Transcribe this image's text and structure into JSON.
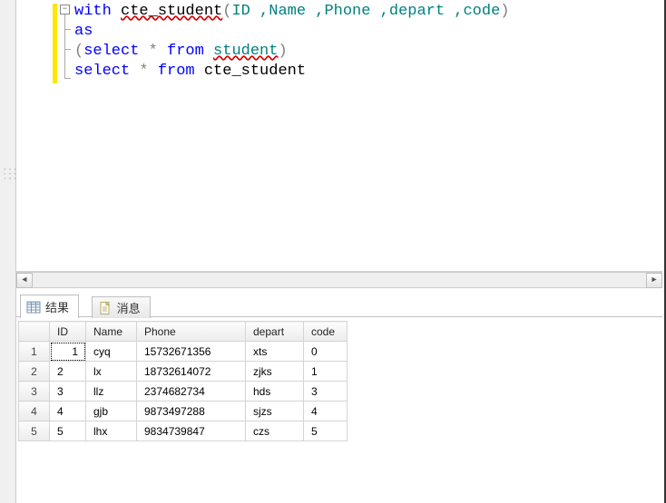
{
  "code": {
    "line1_with": "with",
    "line1_cte": "cte_student",
    "line1_open": "(",
    "line1_cols": "ID ,Name ,Phone ,depart ,code",
    "line1_close": ")",
    "line2_as": "as",
    "line3_open": "(",
    "line3_select": "select",
    "line3_star": " * ",
    "line3_from": "from",
    "line3_space": " ",
    "line3_table": "student",
    "line3_close": ")",
    "line4_select": "select",
    "line4_star": " * ",
    "line4_from": "from",
    "line4_space": " ",
    "line4_target": "cte_student"
  },
  "tabs": {
    "results_label": "结果",
    "messages_label": "消息"
  },
  "grid": {
    "headers": {
      "id": "ID",
      "name": "Name",
      "phone": "Phone",
      "depart": "depart",
      "code": "code"
    },
    "rows": [
      {
        "n": "1",
        "id": "1",
        "name": "cyq",
        "phone": "15732671356",
        "depart": "xts",
        "code": "0"
      },
      {
        "n": "2",
        "id": "2",
        "name": "lx",
        "phone": "18732614072",
        "depart": "zjks",
        "code": "1"
      },
      {
        "n": "3",
        "id": "3",
        "name": "llz",
        "phone": "2374682734",
        "depart": "hds",
        "code": "3"
      },
      {
        "n": "4",
        "id": "4",
        "name": "gjb",
        "phone": "9873497288",
        "depart": "sjzs",
        "code": "4"
      },
      {
        "n": "5",
        "id": "5",
        "name": "lhx",
        "phone": "9834739847",
        "depart": "czs",
        "code": "5"
      }
    ]
  },
  "chart_data": {
    "type": "table",
    "title": "cte_student results",
    "columns": [
      "ID",
      "Name",
      "Phone",
      "depart",
      "code"
    ],
    "rows": [
      [
        1,
        "cyq",
        "15732671356",
        "xts",
        0
      ],
      [
        2,
        "lx",
        "18732614072",
        "zjks",
        1
      ],
      [
        3,
        "llz",
        "2374682734",
        "hds",
        3
      ],
      [
        4,
        "gjb",
        "9873497288",
        "sjzs",
        4
      ],
      [
        5,
        "lhx",
        "9834739847",
        "czs",
        5
      ]
    ]
  }
}
